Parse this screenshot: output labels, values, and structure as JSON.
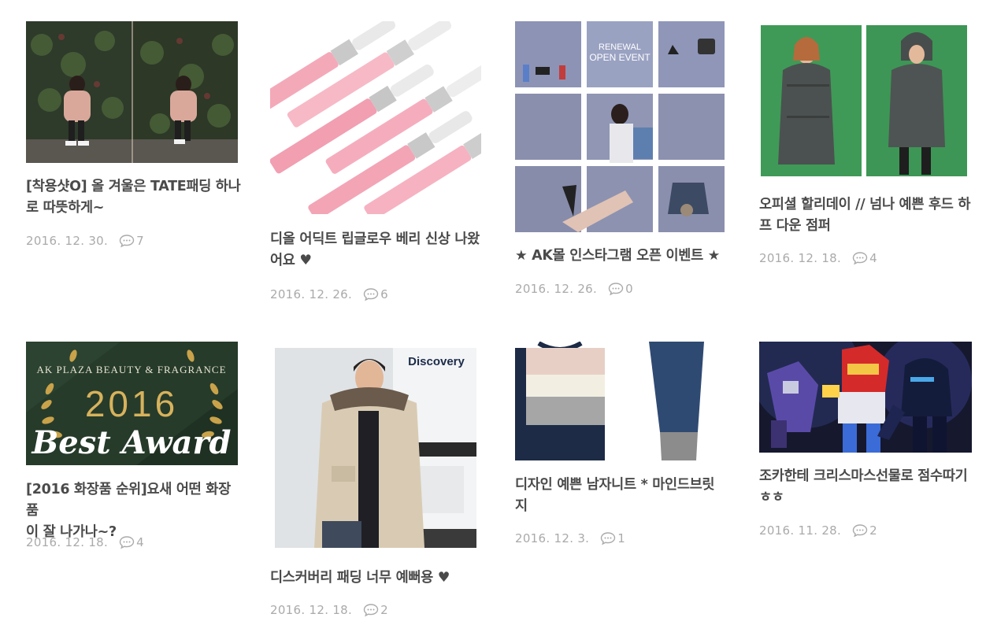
{
  "posts": [
    {
      "title_line1": "[착용샷O] 올 겨울은 TATE패딩 하나",
      "title_line2": "로 따뜻하게~",
      "date": "2016. 12. 30.",
      "comments": "7",
      "image": "two-photos-pink-padded-jacket-ivy-wall"
    },
    {
      "title_line1": "디올 어딕트 립글로우 베리 신상 나왔",
      "title_line2": "어요 ♥",
      "date": "2016. 12. 26.",
      "comments": "6",
      "image": "pink-lip-gloss-tubes"
    },
    {
      "title_line1": "★ AK몰 인스타그램 오픈 이벤트 ★",
      "title_line2": "",
      "date": "2016. 12. 26.",
      "comments": "0",
      "image": "instagram-grid-collage",
      "banner_line1": "RENEWAL",
      "banner_line2": "OPEN EVENT"
    },
    {
      "title_line1": "오피셜 할리데이 // 넘나 예쁜 후드 하",
      "title_line2": "프 다운 점퍼",
      "date": "2016. 12. 18.",
      "comments": "4",
      "image": "two-photos-green-down-jacket"
    },
    {
      "title_line1": "[2016 화장품 순위]요새 어떤 화장품",
      "title_line2": "이 잘 나가나~?",
      "date": "2016. 12. 18.",
      "comments": "4",
      "image": "best-award-banner",
      "banner_top": "AK PLAZA BEAUTY & FRAGRANCE",
      "banner_year": "2016",
      "banner_award": "Best Award"
    },
    {
      "title_line1": "디스커버리 패딩 너무 예뻐용 ♥",
      "title_line2": "",
      "date": "2016. 12. 18.",
      "comments": "2",
      "image": "man-in-padded-parka-by-van",
      "brand": "Discovery"
    },
    {
      "title_line1": "디자인 예쁜 남자니트  * 마인드브릿",
      "title_line2": "지",
      "date": "2016. 12. 3.",
      "comments": "1",
      "image": "colorblock-knit-sweater"
    },
    {
      "title_line1": "조카한테 크리스마스선물로 점수따기",
      "title_line2": "ㅎㅎ",
      "date": "2016. 11. 28.",
      "comments": "2",
      "image": "robot-toys-illustration"
    }
  ],
  "icons": {
    "comment": "speech-bubble-icon"
  },
  "colors": {
    "title": "#4a4a4a",
    "meta": "#aaaaaa"
  }
}
